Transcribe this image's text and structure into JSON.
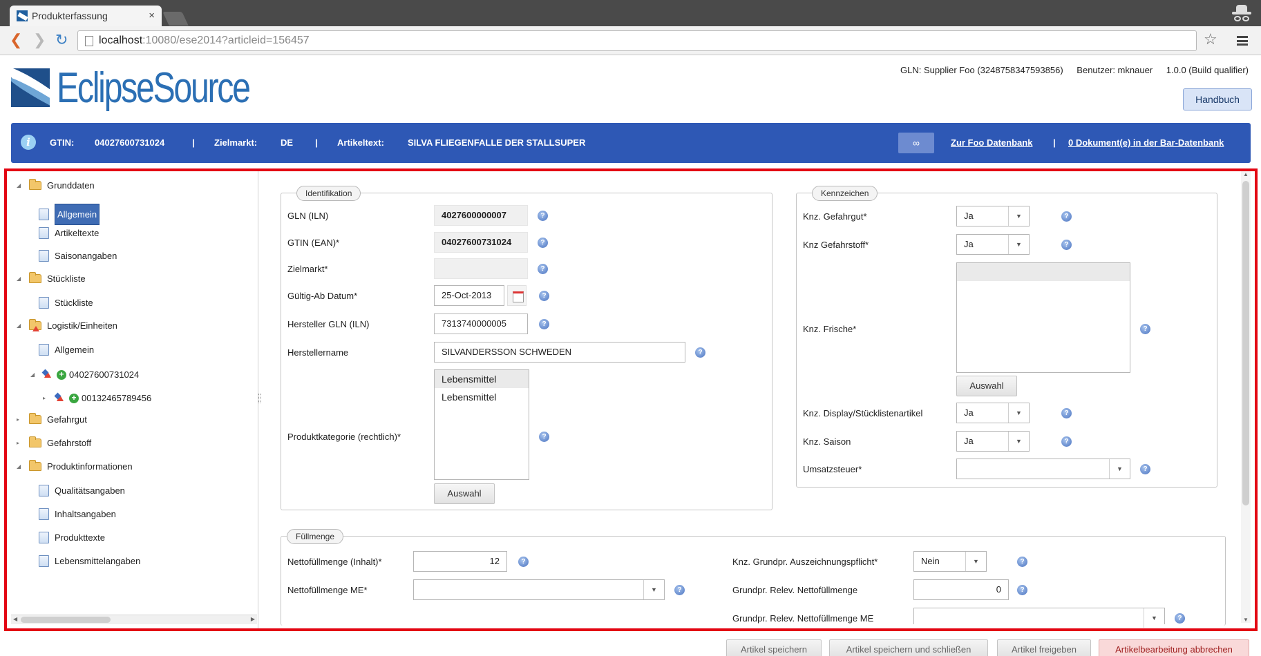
{
  "browser": {
    "tab_title": "Produkterfassung",
    "tab_close": "×",
    "url_host": "localhost",
    "url_rest": ":10080/ese2014?articleid=156457"
  },
  "header": {
    "logo_text": "EclipseSource",
    "gln": "GLN: Supplier Foo (3248758347593856)",
    "user": "Benutzer: mknauer",
    "version": "1.0.0 (Build qualifier)",
    "handbuch_label": "Handbuch"
  },
  "infobar": {
    "gtin_label": "GTIN:",
    "gtin_value": "04027600731024",
    "sep": "|",
    "zielmarkt_label": "Zielmarkt:",
    "zielmarkt_value": "DE",
    "artikeltext_label": "Artikeltext:",
    "artikeltext_value": "SILVA FLIEGENFALLE DER STALLSUPER",
    "link_symbol": "∞",
    "foo_link": "Zur Foo Datenbank",
    "bar_link": "0 Dokument(e) in der Bar-Datenbank"
  },
  "tree": [
    {
      "label": "Grunddaten",
      "type": "folder",
      "expanded": true
    },
    {
      "label": "Allgemein",
      "type": "doc",
      "selected": true
    },
    {
      "label": "Artikeltexte",
      "type": "doc"
    },
    {
      "label": "Saisonangaben",
      "type": "doc"
    },
    {
      "label": "Stückliste",
      "type": "folder",
      "expanded": true
    },
    {
      "label": "Stückliste",
      "type": "doc"
    },
    {
      "label": "Logistik/Einheiten",
      "type": "folder",
      "expanded": true,
      "warning": true
    },
    {
      "label": "Allgemein",
      "type": "doc"
    },
    {
      "label": "04027600731024",
      "type": "unit",
      "expanded": true
    },
    {
      "label": "00132465789456",
      "type": "unit",
      "expanded": false
    },
    {
      "label": "Gefahrgut",
      "type": "folder",
      "expanded": false
    },
    {
      "label": "Gefahrstoff",
      "type": "folder",
      "expanded": false
    },
    {
      "label": "Produktinformationen",
      "type": "folder",
      "expanded": true
    },
    {
      "label": "Qualitätsangaben",
      "type": "doc"
    },
    {
      "label": "Inhaltsangaben",
      "type": "doc"
    },
    {
      "label": "Produkttexte",
      "type": "doc"
    },
    {
      "label": "Lebensmittelangaben",
      "type": "doc"
    }
  ],
  "identifikation": {
    "legend": "Identifikation",
    "gln_label": "GLN (ILN)",
    "gln_value": "4027600000007",
    "gtin_label": "GTIN (EAN)*",
    "gtin_value": "04027600731024",
    "zielmarkt_label": "Zielmarkt*",
    "zielmarkt_value": "",
    "gueltig_label": "Gültig-Ab Datum*",
    "gueltig_value": "25-Oct-2013",
    "hersteller_gln_label": "Hersteller GLN (ILN)",
    "hersteller_gln_value": "7313740000005",
    "herstellername_label": "Herstellername",
    "herstellername_value": "SILVANDERSSON SCHWEDEN",
    "produktkategorie_label": "Produktkategorie (rechtlich)*",
    "produktkategorie_options": [
      "Lebensmittel",
      "Lebensmittel"
    ],
    "auswahl_label": "Auswahl"
  },
  "kennzeichen": {
    "legend": "Kennzeichen",
    "gefahrgut_label": "Knz. Gefahrgut*",
    "gefahrgut_value": "Ja",
    "gefahrstoff_label": "Knz Gefahrstoff*",
    "gefahrstoff_value": "Ja",
    "frische_label": "Knz. Frische*",
    "auswahl_label": "Auswahl",
    "display_label": "Knz. Display/Stücklistenartikel",
    "display_value": "Ja",
    "saison_label": "Knz. Saison",
    "saison_value": "Ja",
    "umsatzsteuer_label": "Umsatzsteuer*",
    "umsatzsteuer_value": ""
  },
  "fuellmenge": {
    "legend": "Füllmenge",
    "netto_inhalt_label": "Nettofüllmenge (Inhalt)*",
    "netto_inhalt_value": "12",
    "netto_me_label": "Nettofüllmenge ME*",
    "netto_me_value": "",
    "grundpr_ausz_label": "Knz. Grundpr. Auszeichnungspflicht*",
    "grundpr_ausz_value": "Nein",
    "grundpr_netto_label": "Grundpr. Relev. Nettofüllmenge",
    "grundpr_netto_value": "0",
    "grundpr_me_label": "Grundpr. Relev. Nettofüllmenge ME",
    "grundpr_me_value": ""
  },
  "footer": {
    "save": "Artikel speichern",
    "save_close": "Artikel speichern und schließen",
    "release": "Artikel freigeben",
    "cancel": "Artikelbearbeitung abbrechen"
  },
  "icons": {
    "help": "?",
    "caret": "▼",
    "tri_open": "◢",
    "tri_closed": "▸",
    "plus": "+",
    "back": "❮",
    "forward": "❯",
    "reload": "↻",
    "star": "☆",
    "scroll_left": "◀",
    "scroll_right": "▶",
    "scroll_up": "▲",
    "scroll_down": "▼"
  },
  "colors": {
    "infobar": "#2e58b5",
    "selection": "#3f6cb4",
    "highlight_frame": "#e30613",
    "cancel_button": "#f9d9d9"
  }
}
